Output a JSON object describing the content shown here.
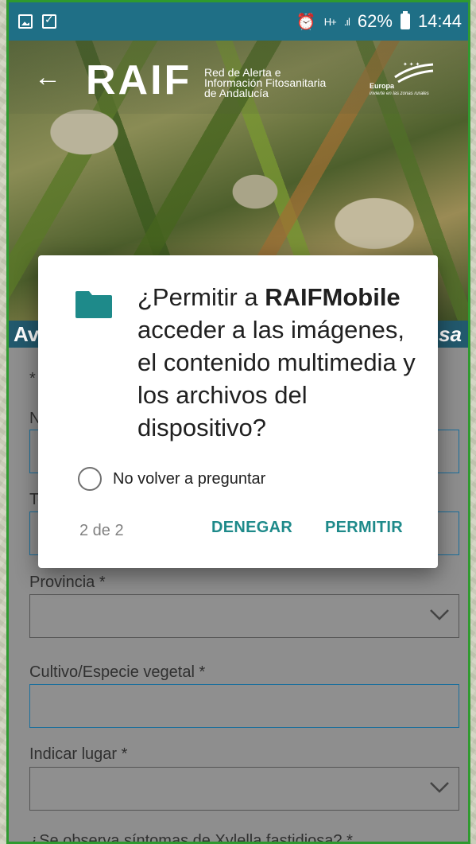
{
  "status_bar": {
    "left_icons": [
      "image-notification-icon",
      "checkbox-notification-icon"
    ],
    "alarm_icon": "alarm-icon",
    "network": "H+",
    "battery": "62%",
    "time": "14:44"
  },
  "header": {
    "logo_text": "RAIF",
    "logo_subtitle_lines": [
      "Red de Alerta e",
      "Información Fitosanitaria",
      "de Andalucía"
    ],
    "eu_label": "Europa",
    "eu_sub": "invierte en las zonas rurales"
  },
  "form": {
    "heading_start": "Av",
    "heading_end": "sa",
    "required_note": "* (",
    "name_label_partial": "No",
    "phone_label_partial": "Te",
    "province_label": "Provincia *",
    "crop_label": "Cultivo/Especie vegetal *",
    "place_label": "Indicar lugar *",
    "symptoms_label": "¿Se observa síntomas de Xylella fastidiosa? *"
  },
  "dialog": {
    "question_prefix": "¿Permitir a ",
    "app_name": "RAIFMobile",
    "question_suffix": " acceder a las imágenes, el contenido multimedia y los archivos del dispositivo?",
    "dont_ask_label": "No volver a preguntar",
    "counter": "2 de 2",
    "deny_label": "DENEGAR",
    "allow_label": "PERMITIR"
  },
  "colors": {
    "status_bar": "#1f6f86",
    "form_heading": "#22596d",
    "accent_teal": "#1e8a8a",
    "frame_green": "#2f9a2f"
  }
}
